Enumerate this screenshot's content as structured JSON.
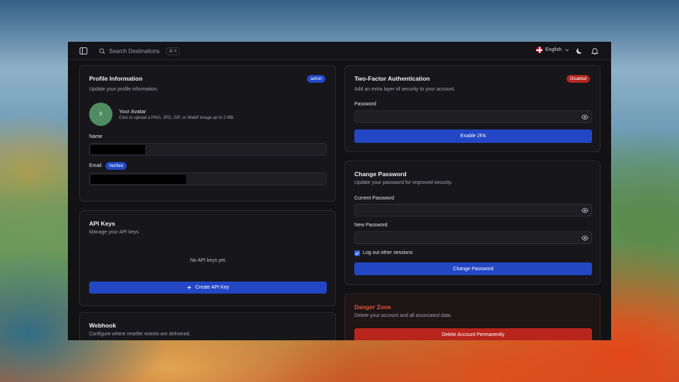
{
  "topbar": {
    "search_placeholder": "Search Destinations",
    "search_shortcut": "⌘ K",
    "language": "English"
  },
  "profile": {
    "title": "Profile Information",
    "role_badge": "admin",
    "description": "Update your profile information.",
    "avatar_initial": "S",
    "avatar_title": "Your Avatar",
    "avatar_hint": "Click to upload a PNG, JPG, GIF, or WebP image up to 2 MB.",
    "name_label": "Name",
    "email_label": "Email",
    "email_badge": "Verified"
  },
  "api_keys": {
    "title": "API Keys",
    "description": "Manage your API keys.",
    "empty_text": "No API keys yet.",
    "create_button": "Create API Key"
  },
  "webhook": {
    "title": "Webhook",
    "description": "Configure where reseller events are delivered."
  },
  "two_factor": {
    "title": "Two-Factor Authentication",
    "status_badge": "Disabled",
    "description": "Add an extra layer of security to your account.",
    "password_label": "Password",
    "enable_button": "Enable 2FA"
  },
  "change_password": {
    "title": "Change Password",
    "description": "Update your password for improved security.",
    "current_label": "Current Password",
    "new_label": "New Password",
    "logout_label": "Log out other sessions",
    "submit_button": "Change Password"
  },
  "danger_zone": {
    "title": "Danger Zone",
    "description": "Delete your account and all associated data.",
    "delete_button": "Delete Account Permanently"
  },
  "colors": {
    "accent": "#2346c5",
    "danger": "#d8472f",
    "disabled_badge": "#b3261e",
    "avatar": "#4f8c62"
  }
}
